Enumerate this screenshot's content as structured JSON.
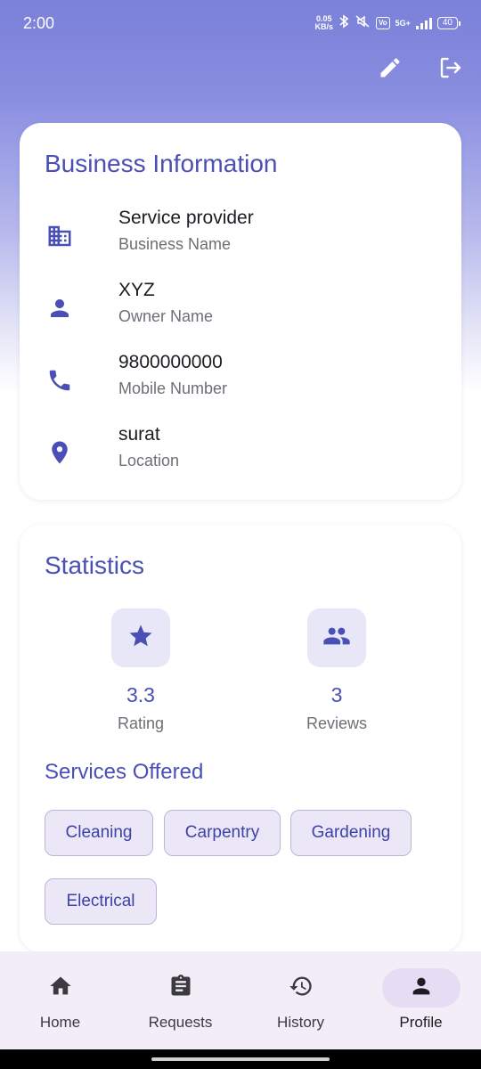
{
  "status_bar": {
    "time": "2:00",
    "net_speed_value": "0.05",
    "net_speed_unit": "KB/s",
    "volte": "Vo\nWiFi",
    "network": "5G+",
    "battery": "40"
  },
  "top_actions": {
    "edit_icon": "pencil-icon",
    "logout_icon": "logout-icon"
  },
  "business": {
    "title": "Business Information",
    "rows": [
      {
        "icon": "business-building-icon",
        "value": "Service provider",
        "label": "Business Name"
      },
      {
        "icon": "person-icon",
        "value": "XYZ",
        "label": "Owner Name"
      },
      {
        "icon": "phone-icon",
        "value": "9800000000",
        "label": "Mobile Number"
      },
      {
        "icon": "location-pin-icon",
        "value": "surat",
        "label": "Location"
      }
    ]
  },
  "statistics": {
    "title": "Statistics",
    "items": [
      {
        "icon": "star-icon",
        "value": "3.3",
        "label": "Rating"
      },
      {
        "icon": "people-icon",
        "value": "3",
        "label": "Reviews"
      }
    ],
    "services_title": "Services Offered",
    "services": [
      "Cleaning",
      "Carpentry",
      "Gardening",
      "Electrical"
    ]
  },
  "bottom_nav": {
    "items": [
      {
        "icon": "home-icon",
        "label": "Home",
        "active": false
      },
      {
        "icon": "clipboard-icon",
        "label": "Requests",
        "active": false
      },
      {
        "icon": "history-icon",
        "label": "History",
        "active": false
      },
      {
        "icon": "person-icon",
        "label": "Profile",
        "active": true
      }
    ]
  },
  "colors": {
    "accent": "#4a4fb5",
    "header_gradient_top": "#7b80d9",
    "nav_background": "#f3edf7",
    "chip_background": "#ebe7f7"
  }
}
